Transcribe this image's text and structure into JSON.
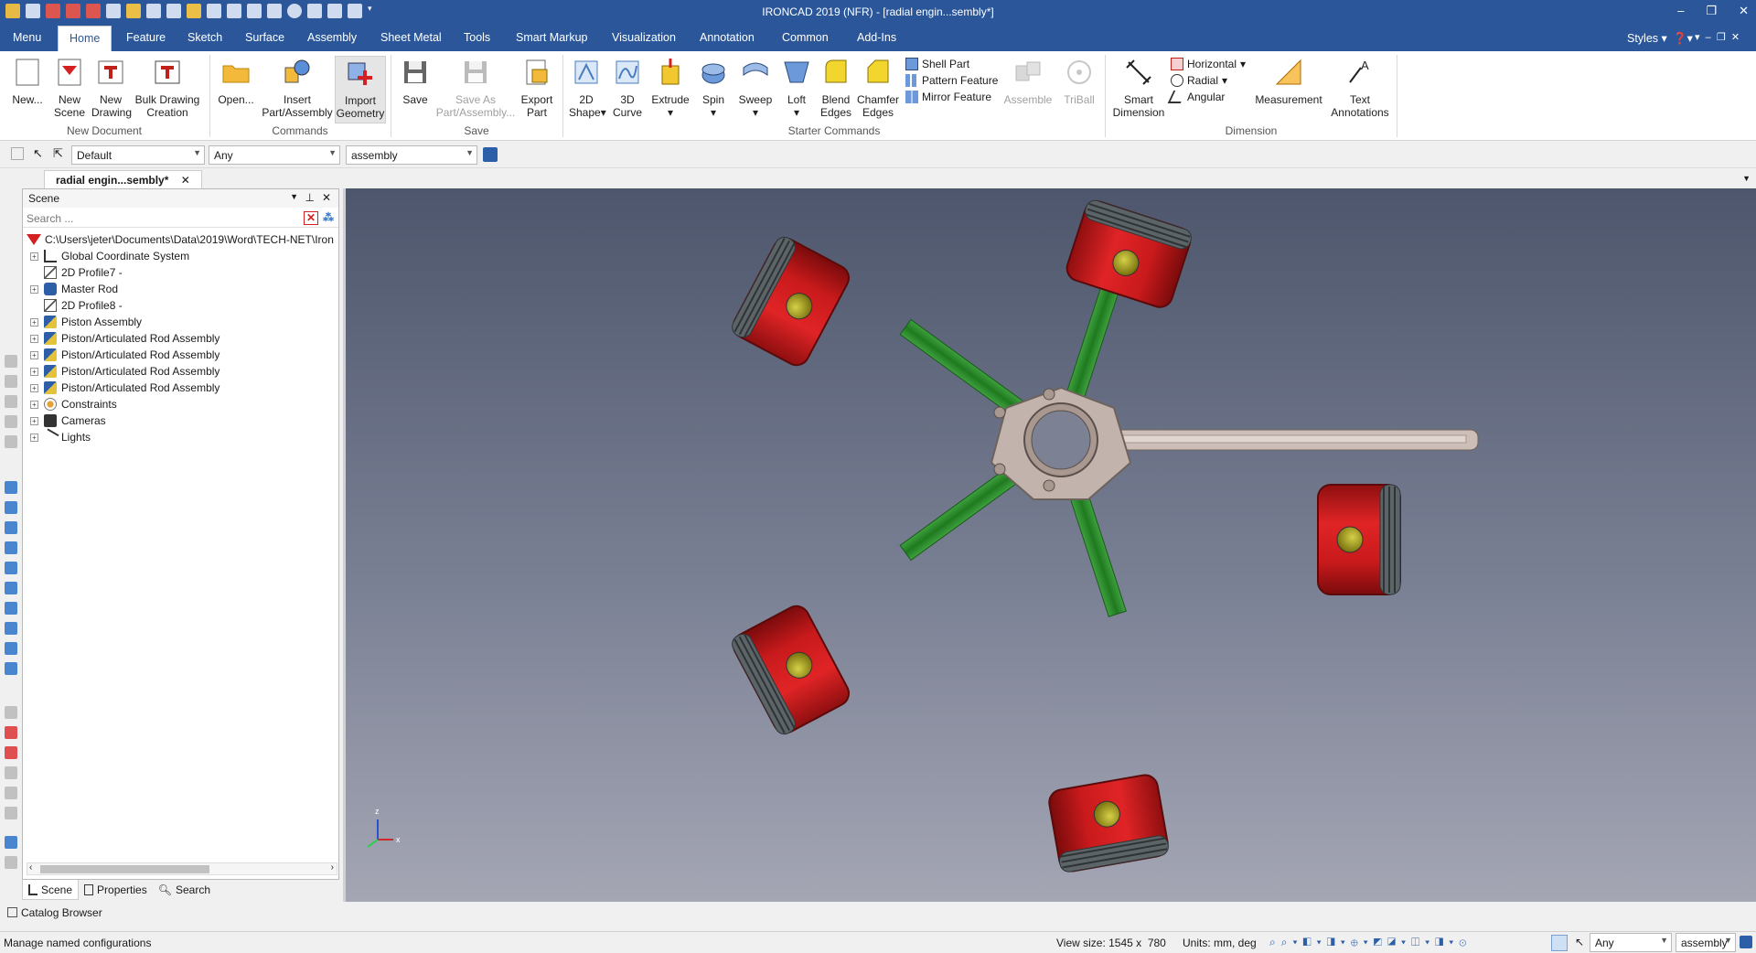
{
  "window": {
    "title": "IRONCAD 2019 (NFR) - [radial engin...sembly*]"
  },
  "tabs": [
    "Menu",
    "Home",
    "Feature",
    "Sketch",
    "Surface",
    "Assembly",
    "Sheet Metal",
    "Tools",
    "Smart Markup",
    "Visualization",
    "Annotation",
    "Common",
    "Add-Ins"
  ],
  "styles_label": "Styles",
  "ribbon": {
    "new_document": {
      "group": "New Document",
      "new": "New...",
      "new_scene": [
        "New",
        "Scene"
      ],
      "new_drawing": [
        "New",
        "Drawing"
      ],
      "bulk": [
        "Bulk Drawing",
        "Creation"
      ]
    },
    "commands": {
      "group": "Commands",
      "open": "Open...",
      "insert": [
        "Insert",
        "Part/Assembly"
      ],
      "import": [
        "Import",
        "Geometry"
      ]
    },
    "save": {
      "group": "Save",
      "save": "Save",
      "save_as": [
        "Save As",
        "Part/Assembly..."
      ],
      "export": [
        "Export",
        "Part"
      ]
    },
    "starter": {
      "group": "Starter Commands",
      "shape2d": [
        "2D",
        "Shape"
      ],
      "curve3d": [
        "3D",
        "Curve"
      ],
      "extrude": "Extrude",
      "spin": "Spin",
      "sweep": "Sweep",
      "loft": "Loft",
      "blend": [
        "Blend",
        "Edges"
      ],
      "chamfer": [
        "Chamfer",
        "Edges"
      ],
      "shell": "Shell Part",
      "pattern": "Pattern Feature",
      "mirror": "Mirror Feature",
      "assemble": "Assemble",
      "triball": "TriBall"
    },
    "dimension": {
      "group": "Dimension",
      "smart": [
        "Smart",
        "Dimension"
      ],
      "horizontal": "Horizontal",
      "radial": "Radial",
      "angular": "Angular",
      "measurement": "Measurement",
      "text": [
        "Text",
        "Annotations"
      ]
    }
  },
  "toolbar2": {
    "config": "Default",
    "filter": "Any",
    "level": "assembly"
  },
  "doc_tab": "radial engin...sembly*",
  "scene": {
    "title": "Scene",
    "search_placeholder": "Search ...",
    "root": "C:\\Users\\jeter\\Documents\\Data\\2019\\Word\\TECH-NET\\Iron",
    "items": [
      {
        "label": "Global Coordinate System",
        "expand": true,
        "icon": "coordinate-icon"
      },
      {
        "label": "2D Profile7 -",
        "expand": false,
        "icon": "profile-icon"
      },
      {
        "label": "Master Rod",
        "expand": true,
        "icon": "part-icon"
      },
      {
        "label": "2D Profile8 -",
        "expand": false,
        "icon": "profile-icon"
      },
      {
        "label": "Piston Assembly",
        "expand": true,
        "icon": "assembly-icon"
      },
      {
        "label": "Piston/Articulated Rod Assembly",
        "expand": true,
        "icon": "assembly-icon"
      },
      {
        "label": "Piston/Articulated Rod Assembly",
        "expand": true,
        "icon": "assembly-icon"
      },
      {
        "label": "Piston/Articulated Rod Assembly",
        "expand": true,
        "icon": "assembly-icon"
      },
      {
        "label": "Piston/Articulated Rod Assembly",
        "expand": true,
        "icon": "assembly-icon"
      },
      {
        "label": "Constraints",
        "expand": true,
        "icon": "constraints-icon"
      },
      {
        "label": "Cameras",
        "expand": true,
        "icon": "camera-icon"
      },
      {
        "label": "Lights",
        "expand": true,
        "icon": "light-icon"
      }
    ],
    "tabs": [
      "Scene",
      "Properties",
      "Search"
    ]
  },
  "catalog_label": "Catalog Browser",
  "status": {
    "message": "Manage named configurations",
    "view_size": "View size: 1545 x  780",
    "units": "Units: mm, deg",
    "filter": "Any",
    "level": "assembly"
  },
  "colors": {
    "title_bar": "#2b579a",
    "piston": "#d4191b",
    "rod": "#2e8b2e",
    "hub": "#c2b4ac",
    "pin": "#b5a800"
  }
}
